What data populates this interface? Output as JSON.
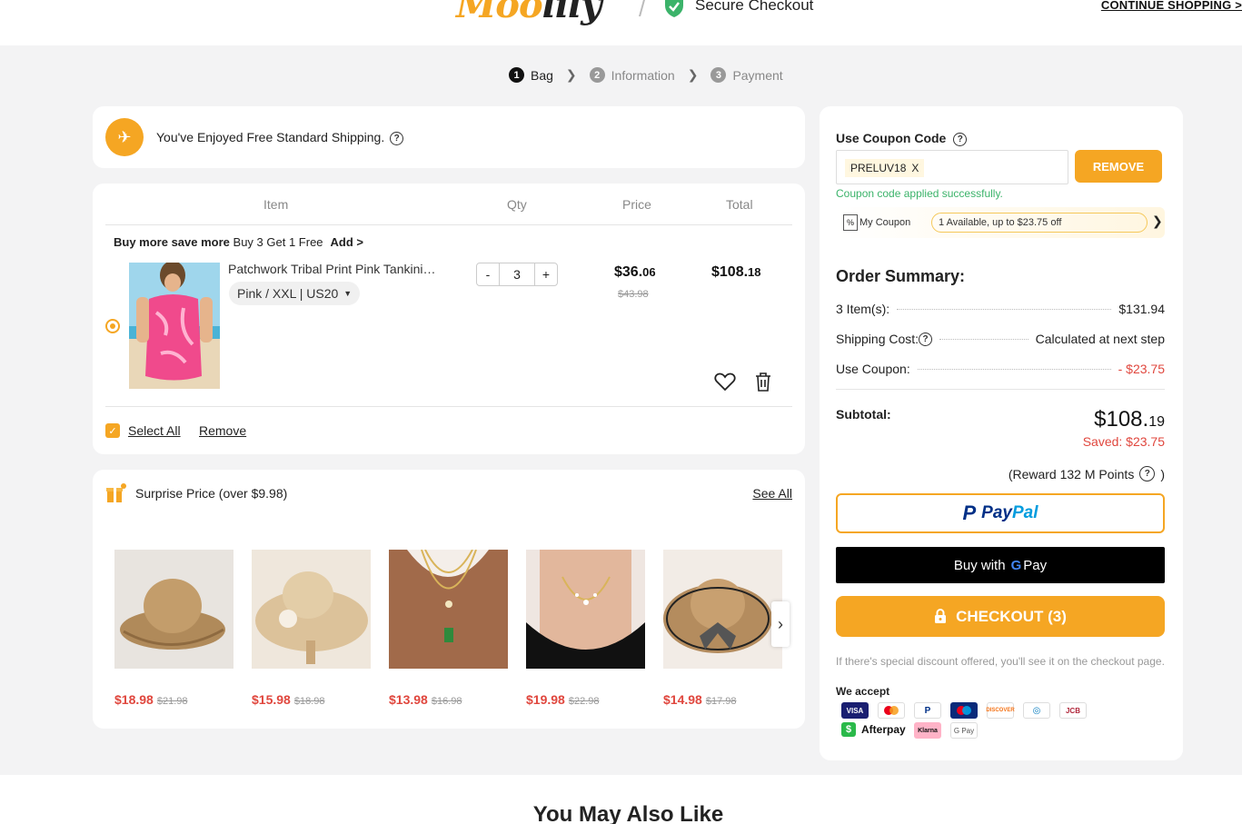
{
  "header": {
    "logo_text": "Moo",
    "logo_tail": "lily",
    "secure_label": "Secure Checkout",
    "continue_label": "CONTINUE SHOPPING >"
  },
  "steps": [
    {
      "num": "1",
      "label": "Bag"
    },
    {
      "num": "2",
      "label": "Information"
    },
    {
      "num": "3",
      "label": "Payment"
    }
  ],
  "shipping_notice": "You've Enjoyed Free Standard Shipping.",
  "cart": {
    "headers": {
      "item": "Item",
      "qty": "Qty",
      "price": "Price",
      "total": "Total"
    },
    "promo_bold": "Buy more save more",
    "promo_text": "Buy 3 Get 1 Free",
    "promo_add": "Add >",
    "product": {
      "name": "Patchwork Tribal Print Pink Tankini Swimsuit",
      "variant": "Pink / XXL | US20",
      "qty": "3",
      "price_main": "$36.",
      "price_cents": "06",
      "old_price": "$43.98",
      "total_main": "$108.",
      "total_cents": "18"
    },
    "select_all": "Select All",
    "remove": "Remove"
  },
  "surprise": {
    "title": "Surprise Price (over $9.98)",
    "see_all": "See All",
    "items": [
      {
        "price": "$18.98",
        "old": "$21.98"
      },
      {
        "price": "$15.98",
        "old": "$18.98"
      },
      {
        "price": "$13.98",
        "old": "$16.98"
      },
      {
        "price": "$19.98",
        "old": "$22.98"
      },
      {
        "price": "$14.98",
        "old": "$17.98"
      }
    ]
  },
  "coupon": {
    "label": "Use Coupon Code",
    "code": "PRELUV18",
    "code_close": "X",
    "remove_label": "REMOVE",
    "success": "Coupon code applied successfully.",
    "my_coupon": "My Coupon",
    "available": "1 Available, up to $23.75 off"
  },
  "summary": {
    "title": "Order Summary:",
    "items_label": "3 Item(s):",
    "items_value": "$131.94",
    "shipping_label": "Shipping Cost:",
    "shipping_value": "Calculated at next step",
    "coupon_label": "Use Coupon:",
    "coupon_value": "- $23.75",
    "subtotal_label": "Subtotal:",
    "subtotal_main": "$108.",
    "subtotal_cents": "19",
    "saved": "Saved: $23.75",
    "reward": "(Reward 132 M Points",
    "reward_close": ")"
  },
  "payment": {
    "paypal_a": "Pay",
    "paypal_b": "Pal",
    "gpay_label": "Buy with",
    "gpay_g": "G",
    "gpay_pay": "Pay",
    "checkout_label": "CHECKOUT (3)",
    "discount_note": "If there's special discount offered, you'll see it on the checkout page.",
    "we_accept": "We accept",
    "cards": [
      "VISA",
      "Mastercard",
      "PayPal",
      "Maestro",
      "DISCOVER",
      "Diners Club",
      "JCB",
      "Afterpay",
      "Klarna",
      "G Pay"
    ]
  },
  "bottom": {
    "title": "You May Also Like"
  },
  "colors": {
    "accent": "#f5a623",
    "sale_red": "#e0473e",
    "success_green": "#3bb36a"
  }
}
